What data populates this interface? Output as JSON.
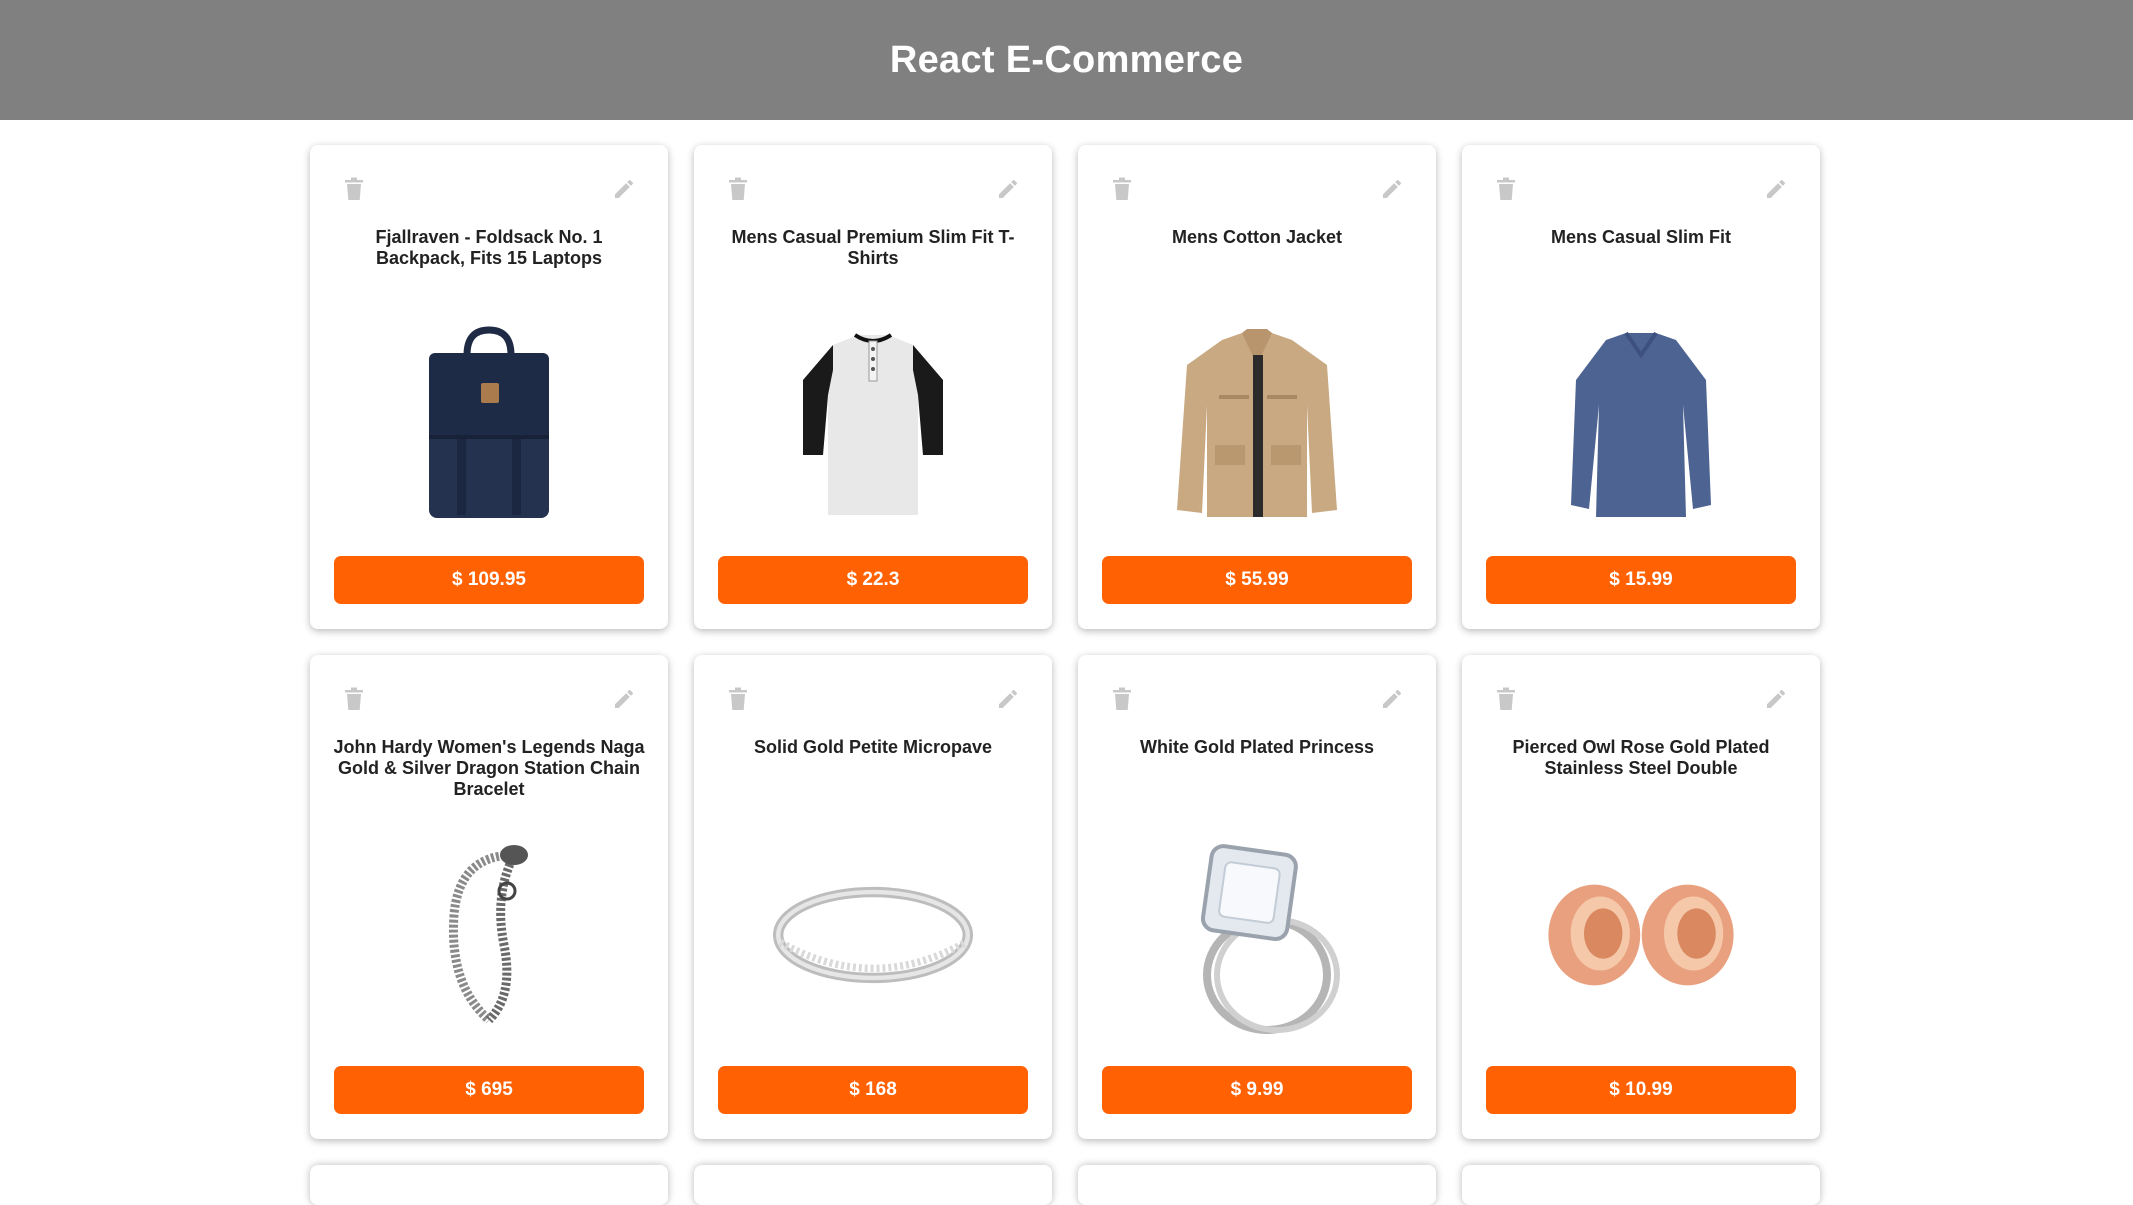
{
  "header": {
    "title": "React E-Commerce"
  },
  "products": [
    {
      "title": "Fjallraven - Foldsack No. 1 Backpack, Fits 15 Laptops",
      "price": "$ 109.95",
      "image": "backpack-image"
    },
    {
      "title": "Mens Casual Premium Slim Fit T-Shirts",
      "price": "$ 22.3",
      "image": "henley-shirt-image"
    },
    {
      "title": "Mens Cotton Jacket",
      "price": "$ 55.99",
      "image": "cotton-jacket-image"
    },
    {
      "title": "Mens Casual Slim Fit",
      "price": "$ 15.99",
      "image": "long-sleeve-shirt-image"
    },
    {
      "title": "John Hardy Women's Legends Naga Gold & Silver Dragon Station Chain Bracelet",
      "price": "$ 695",
      "image": "dragon-bracelet-image"
    },
    {
      "title": "Solid Gold Petite Micropave",
      "price": "$ 168",
      "image": "micropave-ring-image"
    },
    {
      "title": "White Gold Plated Princess",
      "price": "$ 9.99",
      "image": "princess-ring-image"
    },
    {
      "title": "Pierced Owl Rose Gold Plated Stainless Steel Double",
      "price": "$ 10.99",
      "image": "rose-gold-tunnels-image"
    }
  ],
  "icons": {
    "delete": "trash-icon",
    "edit": "pencil-icon"
  },
  "colors": {
    "header_bg": "#808080",
    "price_button": "#ff6103",
    "icon_gray": "#c8c8c8"
  }
}
